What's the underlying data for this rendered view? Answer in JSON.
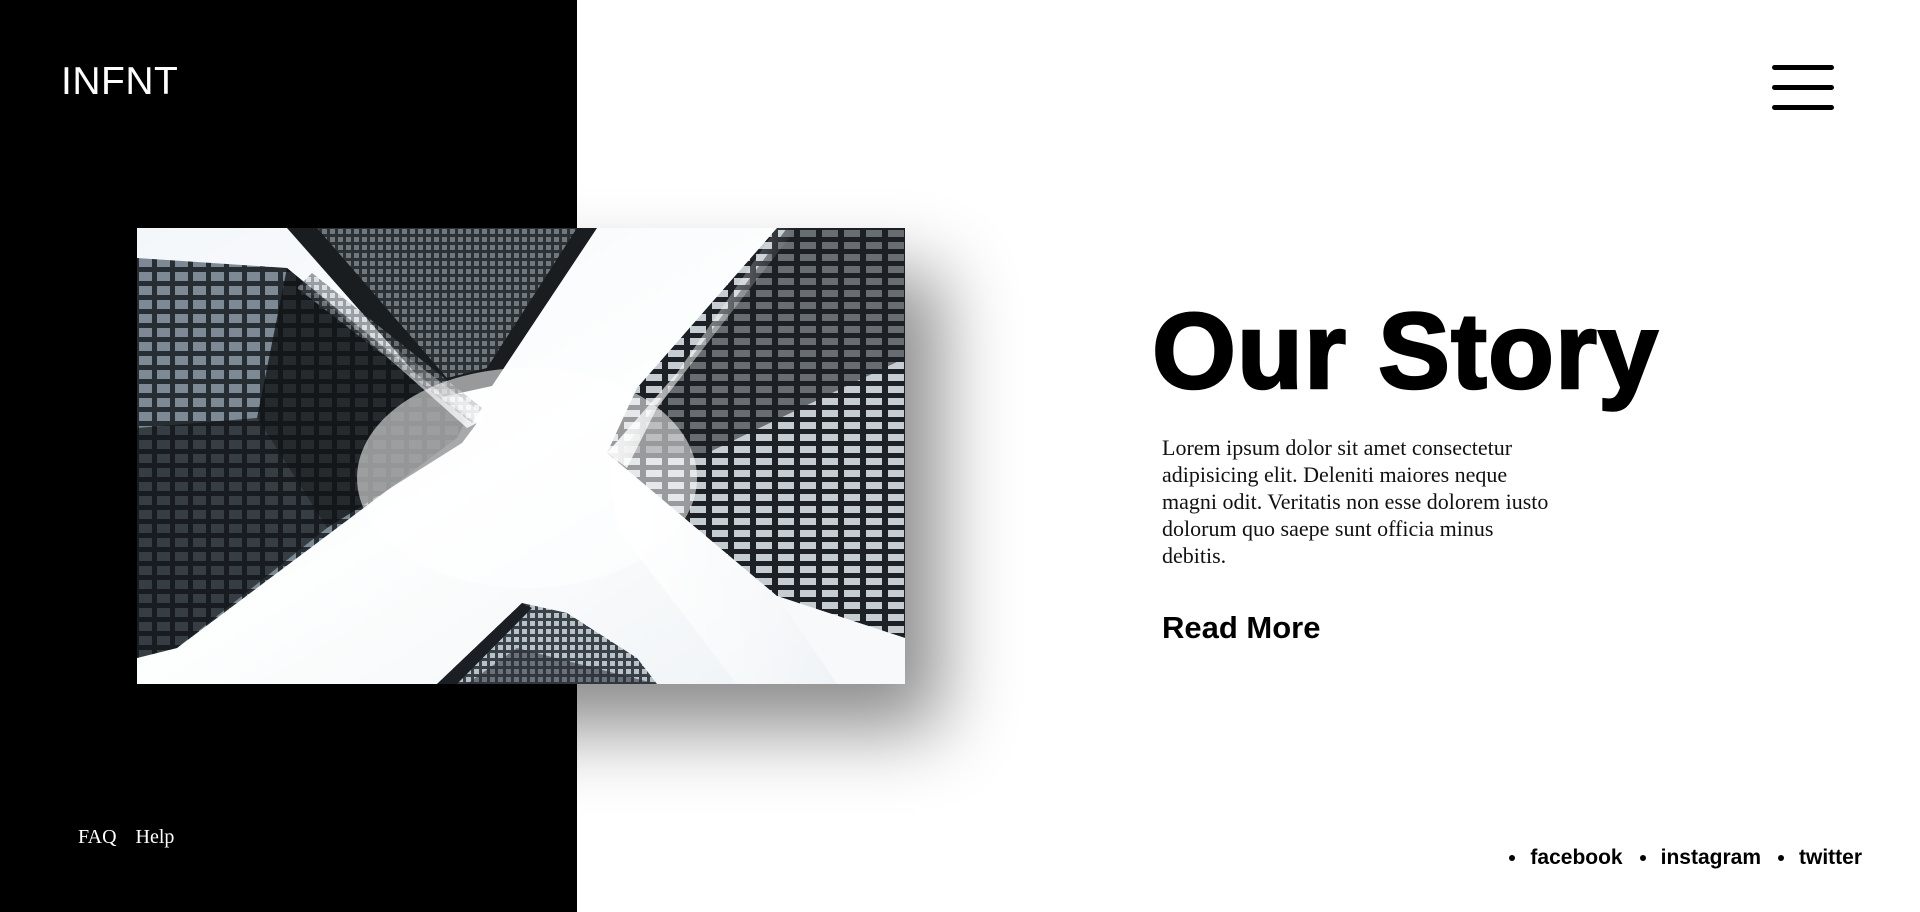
{
  "brand": {
    "logo": "INFNT"
  },
  "header": {
    "menu_icon": "hamburger-menu-icon"
  },
  "hero": {
    "image_alt": "Looking up at skyscrapers",
    "title": "Our Story",
    "body": "Lorem ipsum dolor sit amet consectetur adipisicing elit. Deleniti maiores neque magni odit. Veritatis non esse dolorem iusto dolorum quo saepe sunt officia minus debitis.",
    "cta": "Read More"
  },
  "footer": {
    "links": [
      {
        "label": "FAQ"
      },
      {
        "label": "Help"
      }
    ]
  },
  "social": {
    "links": [
      {
        "label": "facebook"
      },
      {
        "label": "instagram"
      },
      {
        "label": "twitter"
      }
    ]
  },
  "colors": {
    "panel": "#000000",
    "background": "#ffffff",
    "text": "#000000"
  }
}
